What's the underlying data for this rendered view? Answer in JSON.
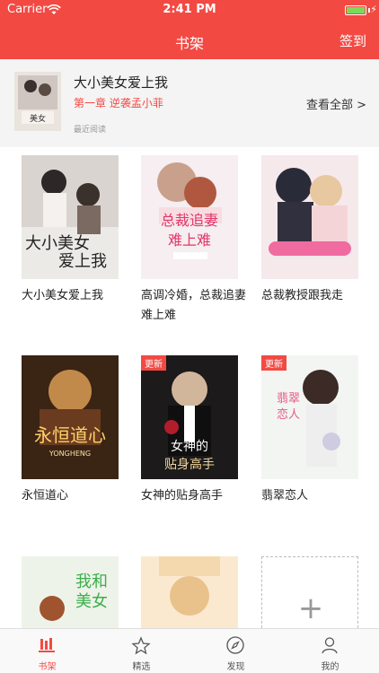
{
  "status": {
    "carrier": "Carrier",
    "time": "2:41 PM"
  },
  "nav": {
    "title": "书架",
    "signin": "签到"
  },
  "recent": {
    "title": "大小美女爱上我",
    "chapter": "第一章  逆袭孟小菲",
    "note": "最近阅读",
    "view_all": "查看全部 >"
  },
  "books": [
    {
      "name": "大小美女爱上我",
      "badge": ""
    },
    {
      "name": "高调冷婚，总裁追妻难上难",
      "badge": ""
    },
    {
      "name": "总裁教授跟我走",
      "badge": ""
    },
    {
      "name": "永恒道心",
      "badge": ""
    },
    {
      "name": "女神的贴身高手",
      "badge": "更新"
    },
    {
      "name": "翡翠恋人",
      "badge": "更新"
    }
  ],
  "add_symbol": "+",
  "tabs": [
    {
      "label": "书架",
      "icon": "bookshelf-icon"
    },
    {
      "label": "精选",
      "icon": "star-icon"
    },
    {
      "label": "发现",
      "icon": "compass-icon"
    },
    {
      "label": "我的",
      "icon": "person-icon"
    }
  ],
  "colors": {
    "accent": "#f24a43",
    "background": "#ffffff",
    "card": "#f4f4f4"
  }
}
